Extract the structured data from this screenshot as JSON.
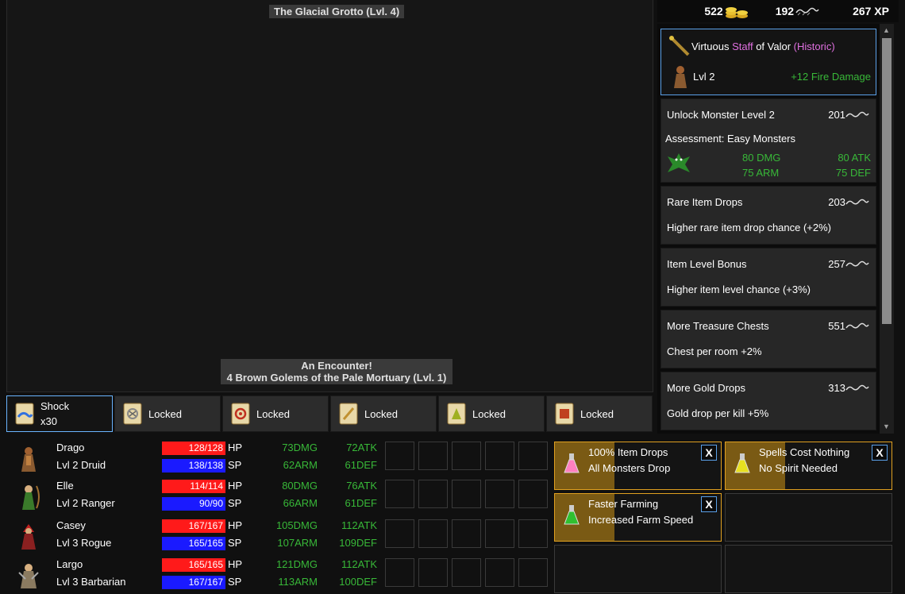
{
  "map": {
    "zone_title": "The Glacial Grotto (Lvl. 4)",
    "encounter_line1": "An Encounter!",
    "encounter_line2": "4 Brown Golems of the Pale Mortuary (Lvl. 1)"
  },
  "skills": [
    {
      "label": "Shock",
      "count": "x30"
    },
    {
      "label": "Locked"
    },
    {
      "label": "Locked"
    },
    {
      "label": "Locked"
    },
    {
      "label": "Locked"
    },
    {
      "label": "Locked"
    }
  ],
  "stats": {
    "gold": "522",
    "gold_icon": "gold-coins-icon",
    "spirit": "192",
    "spirit_icon": "spirit-icon",
    "xp": "267 XP"
  },
  "item": {
    "prefix": "Virtuous ",
    "type": "Staff",
    "suffix": " of Valor ",
    "rarity": "(Historic)",
    "level": "Lvl 2",
    "bonus": "+12 Fire Damage",
    "rarity_color": "#e070e0"
  },
  "upgrades": [
    {
      "title": "Unlock Monster Level 2",
      "cost": "201",
      "desc": "Assessment: Easy Monsters",
      "monster": {
        "dmg": "80 DMG",
        "atk": "80 ATK",
        "arm": "75 ARM",
        "def": "75 DEF"
      }
    },
    {
      "title": "Rare Item Drops",
      "cost": "203",
      "desc": "Higher rare item drop chance (+2%)"
    },
    {
      "title": "Item Level Bonus",
      "cost": "257",
      "desc": "Higher item level chance (+3%)"
    },
    {
      "title": "More Treasure Chests",
      "cost": "551",
      "desc": "Chest per room +2%"
    },
    {
      "title": "More Gold Drops",
      "cost": "313",
      "desc": "Gold drop per kill +5%"
    }
  ],
  "party": [
    {
      "name": "Drago",
      "level": "Lvl 2 Druid",
      "hp": "128/128",
      "sp": "138/138",
      "dmg": "73",
      "atk": "72",
      "arm": "62",
      "def": "61"
    },
    {
      "name": "Elle",
      "level": "Lvl 2 Ranger",
      "hp": "114/114",
      "sp": "90/90",
      "dmg": "80",
      "atk": "76",
      "arm": "66",
      "def": "61"
    },
    {
      "name": "Casey",
      "level": "Lvl 3 Rogue",
      "hp": "167/167",
      "sp": "165/165",
      "dmg": "105",
      "atk": "112",
      "arm": "107",
      "def": "109"
    },
    {
      "name": "Largo",
      "level": "Lvl 3 Barbarian",
      "hp": "165/165",
      "sp": "167/167",
      "dmg": "121",
      "atk": "112",
      "arm": "113",
      "def": "100"
    }
  ],
  "labels": {
    "hp": "HP",
    "sp": "SP",
    "dmg": "DMG",
    "atk": "ATK",
    "arm": "ARM",
    "def": "DEF"
  },
  "buffs": [
    {
      "line1": "100% Item Drops",
      "line2": "All Monsters Drop",
      "close": "X",
      "remaining": 0.36,
      "icon": "pink-potion-icon"
    },
    {
      "line1": "Spells Cost Nothing",
      "line2": "No Spirit Needed",
      "close": "X",
      "remaining": 0.36,
      "icon": "yellow-potion-icon"
    },
    {
      "line1": "Faster Farming",
      "line2": "Increased Farm Speed",
      "close": "X",
      "remaining": 0.36,
      "icon": "green-potion-icon"
    }
  ],
  "colors": {
    "hp_bar": "#ff1a1a",
    "sp_bar": "#1a1aff",
    "stat_green": "#38b838",
    "buff_border": "#e0a020",
    "selection": "#5aa0e8"
  }
}
